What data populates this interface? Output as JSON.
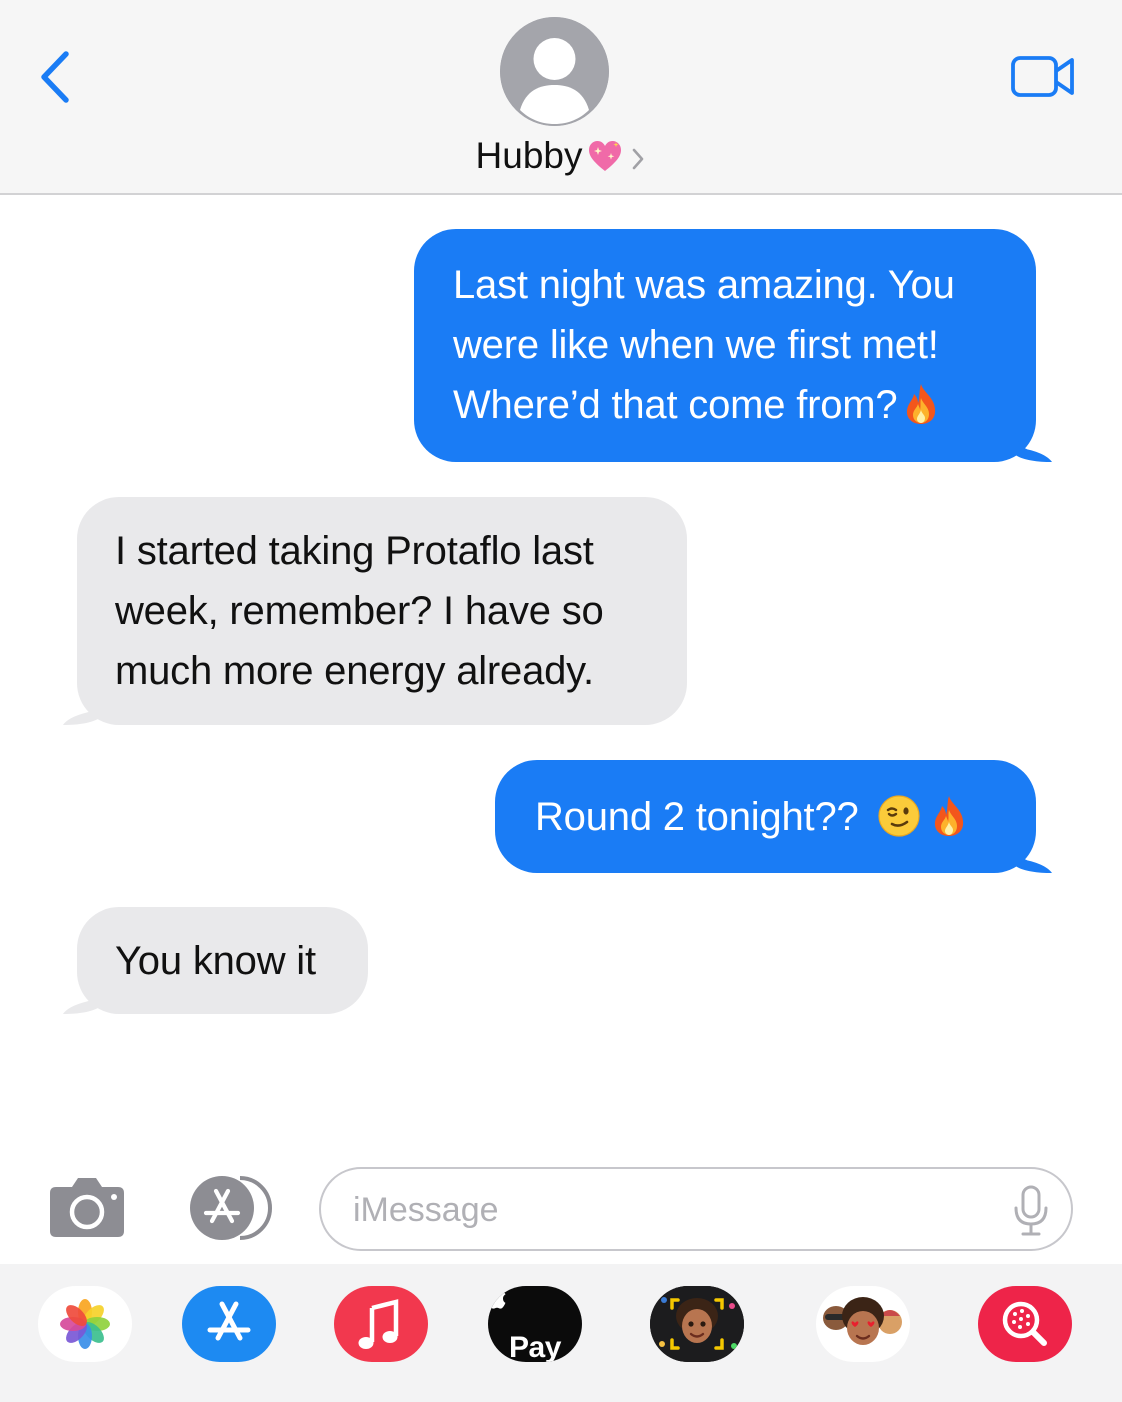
{
  "header": {
    "contact_name": "Hubby",
    "back_icon": "chevron-left-icon",
    "video_icon": "video-camera-icon",
    "accent_color": "#1a7cf5"
  },
  "messages": [
    {
      "direction": "outgoing",
      "lines": [
        "Last night was amazing. You",
        "were like when we first met!",
        "Where’d that come from?"
      ],
      "emoji": [
        "fire"
      ]
    },
    {
      "direction": "incoming",
      "lines": [
        "I started taking Protaflo last",
        "week, remember? I have so",
        "much more energy already."
      ]
    },
    {
      "direction": "outgoing",
      "lines": [
        "Round 2 tonight??"
      ],
      "emoji": [
        "winking-face",
        "fire"
      ]
    },
    {
      "direction": "incoming",
      "lines": [
        "You know it"
      ]
    }
  ],
  "composer": {
    "placeholder": "iMessage",
    "value": ""
  },
  "app_drawer": {
    "apple_pay_label": "Pay",
    "apps": [
      "photos-icon",
      "app-store-icon",
      "music-icon",
      "apple-pay-icon",
      "memoji-icon",
      "memoji-stickers-icon",
      "image-search-icon"
    ]
  },
  "colors": {
    "outgoing_bubble": "#1a7cf5",
    "incoming_bubble": "#e9e9eb",
    "header_bg": "#f6f6f6"
  }
}
